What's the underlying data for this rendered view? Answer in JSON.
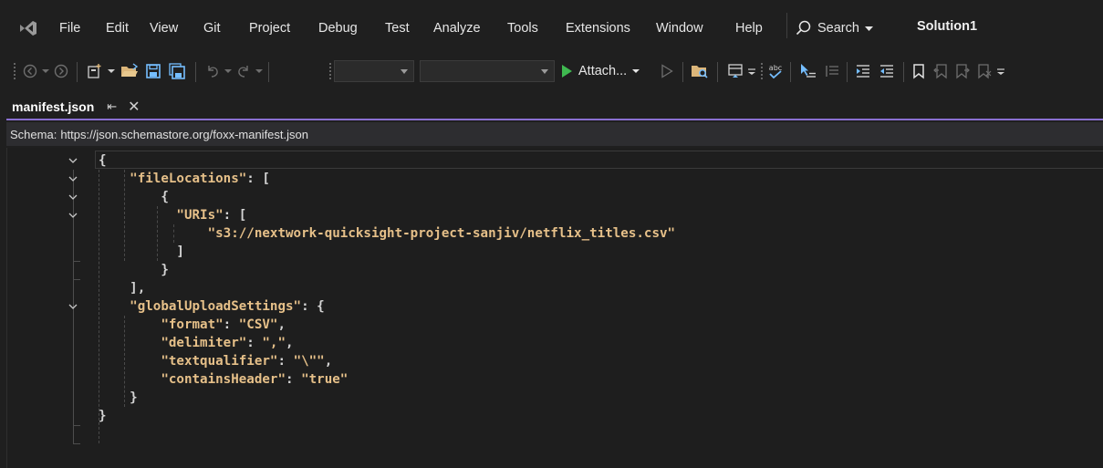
{
  "menu": {
    "items": [
      "File",
      "Edit",
      "View",
      "Git",
      "Project",
      "Debug",
      "Test",
      "Analyze",
      "Tools",
      "Extensions",
      "Window",
      "Help"
    ],
    "search_label": "Search",
    "solution_name": "Solution1"
  },
  "toolbar": {
    "attach_label": "Attach...",
    "spellcheck_text": "abc"
  },
  "tabs": [
    {
      "label": "manifest.json",
      "active": true,
      "pin_icon": "pin-icon",
      "close_icon": "close-icon"
    }
  ],
  "schema": {
    "label": "Schema:",
    "url": "https://json.schemastore.org/foxx-manifest.json"
  },
  "editor": {
    "lines": [
      [
        {
          "c": "p",
          "t": "{"
        }
      ],
      [
        {
          "c": "k",
          "t": "    \"fileLocations\""
        },
        {
          "c": "p",
          "t": ": ["
        }
      ],
      [
        {
          "c": "p",
          "t": "        {"
        }
      ],
      [
        {
          "c": "k",
          "t": "          \"URIs\""
        },
        {
          "c": "p",
          "t": ": ["
        }
      ],
      [
        {
          "c": "s",
          "t": "              \"s3://nextwork-quicksight-project-sanjiv/netflix_titles.csv\""
        }
      ],
      [
        {
          "c": "p",
          "t": "          ]"
        }
      ],
      [
        {
          "c": "p",
          "t": "        }"
        }
      ],
      [
        {
          "c": "p",
          "t": "    ],"
        }
      ],
      [
        {
          "c": "k",
          "t": "    \"globalUploadSettings\""
        },
        {
          "c": "p",
          "t": ": {"
        }
      ],
      [
        {
          "c": "k",
          "t": "        \"format\""
        },
        {
          "c": "p",
          "t": ": "
        },
        {
          "c": "s",
          "t": "\"CSV\""
        },
        {
          "c": "p",
          "t": ","
        }
      ],
      [
        {
          "c": "k",
          "t": "        \"delimiter\""
        },
        {
          "c": "p",
          "t": ": "
        },
        {
          "c": "s",
          "t": "\",\""
        },
        {
          "c": "p",
          "t": ","
        }
      ],
      [
        {
          "c": "k",
          "t": "        \"textqualifier\""
        },
        {
          "c": "p",
          "t": ": "
        },
        {
          "c": "s",
          "t": "\"\\\"\""
        },
        {
          "c": "p",
          "t": ","
        }
      ],
      [
        {
          "c": "k",
          "t": "        \"containsHeader\""
        },
        {
          "c": "p",
          "t": ": "
        },
        {
          "c": "s",
          "t": "\"true\""
        }
      ],
      [
        {
          "c": "p",
          "t": "    }"
        }
      ],
      [
        {
          "c": "p",
          "t": "}"
        }
      ]
    ],
    "fold_lines": [
      0,
      1,
      2,
      3,
      8
    ]
  },
  "colors": {
    "accent": "#8a6fd1",
    "json_key": "#e6c089",
    "play_green": "#3fb950",
    "folder_yellow": "#dcb67a",
    "bookmark_blue": "#75beff"
  }
}
